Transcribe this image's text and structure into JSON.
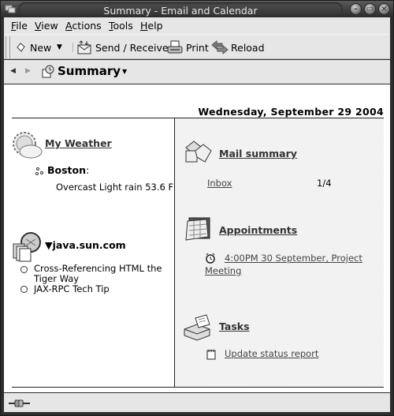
{
  "window": {
    "title": "Summary - Email and Calendar",
    "controls": [
      "minimize",
      "maximize",
      "close"
    ]
  },
  "menubar": {
    "items": [
      {
        "label": "File",
        "mnemonic": "F",
        "rest": "ile"
      },
      {
        "label": "View",
        "mnemonic": "V",
        "rest": "iew"
      },
      {
        "label": "Actions",
        "mnemonic": "A",
        "rest": "ctions"
      },
      {
        "label": "Tools",
        "mnemonic": "T",
        "rest": "ools"
      },
      {
        "label": "Help",
        "mnemonic": "H",
        "rest": "elp"
      }
    ]
  },
  "toolbar": {
    "new_label": "New",
    "send_receive_label": "Send / Receive",
    "print_label": "Print",
    "reload_label": "Reload"
  },
  "switcher": {
    "title": "Summary"
  },
  "summary": {
    "date": "Wednesday, September 29 2004",
    "weather": {
      "title": "My Weather",
      "city": "Boston",
      "city_suffix": ":",
      "conditions": "Overcast Light rain 53.6 F"
    },
    "rss": {
      "title": "java.sun.com",
      "items": [
        {
          "line1": "Cross-Referencing HTML the",
          "line2": "Tiger Way"
        },
        {
          "line1": "JAX-RPC Tech Tip",
          "line2": ""
        }
      ]
    },
    "mail": {
      "title": "Mail summary",
      "folders": [
        {
          "name": "Inbox",
          "count": "1/4"
        }
      ]
    },
    "appointments": {
      "title": "Appointments",
      "items": [
        {
          "line1": "4:00PM 30 September, Project",
          "line2": "Meeting"
        }
      ]
    },
    "tasks": {
      "title": "Tasks",
      "items": [
        {
          "label": "Update status report"
        }
      ]
    }
  }
}
